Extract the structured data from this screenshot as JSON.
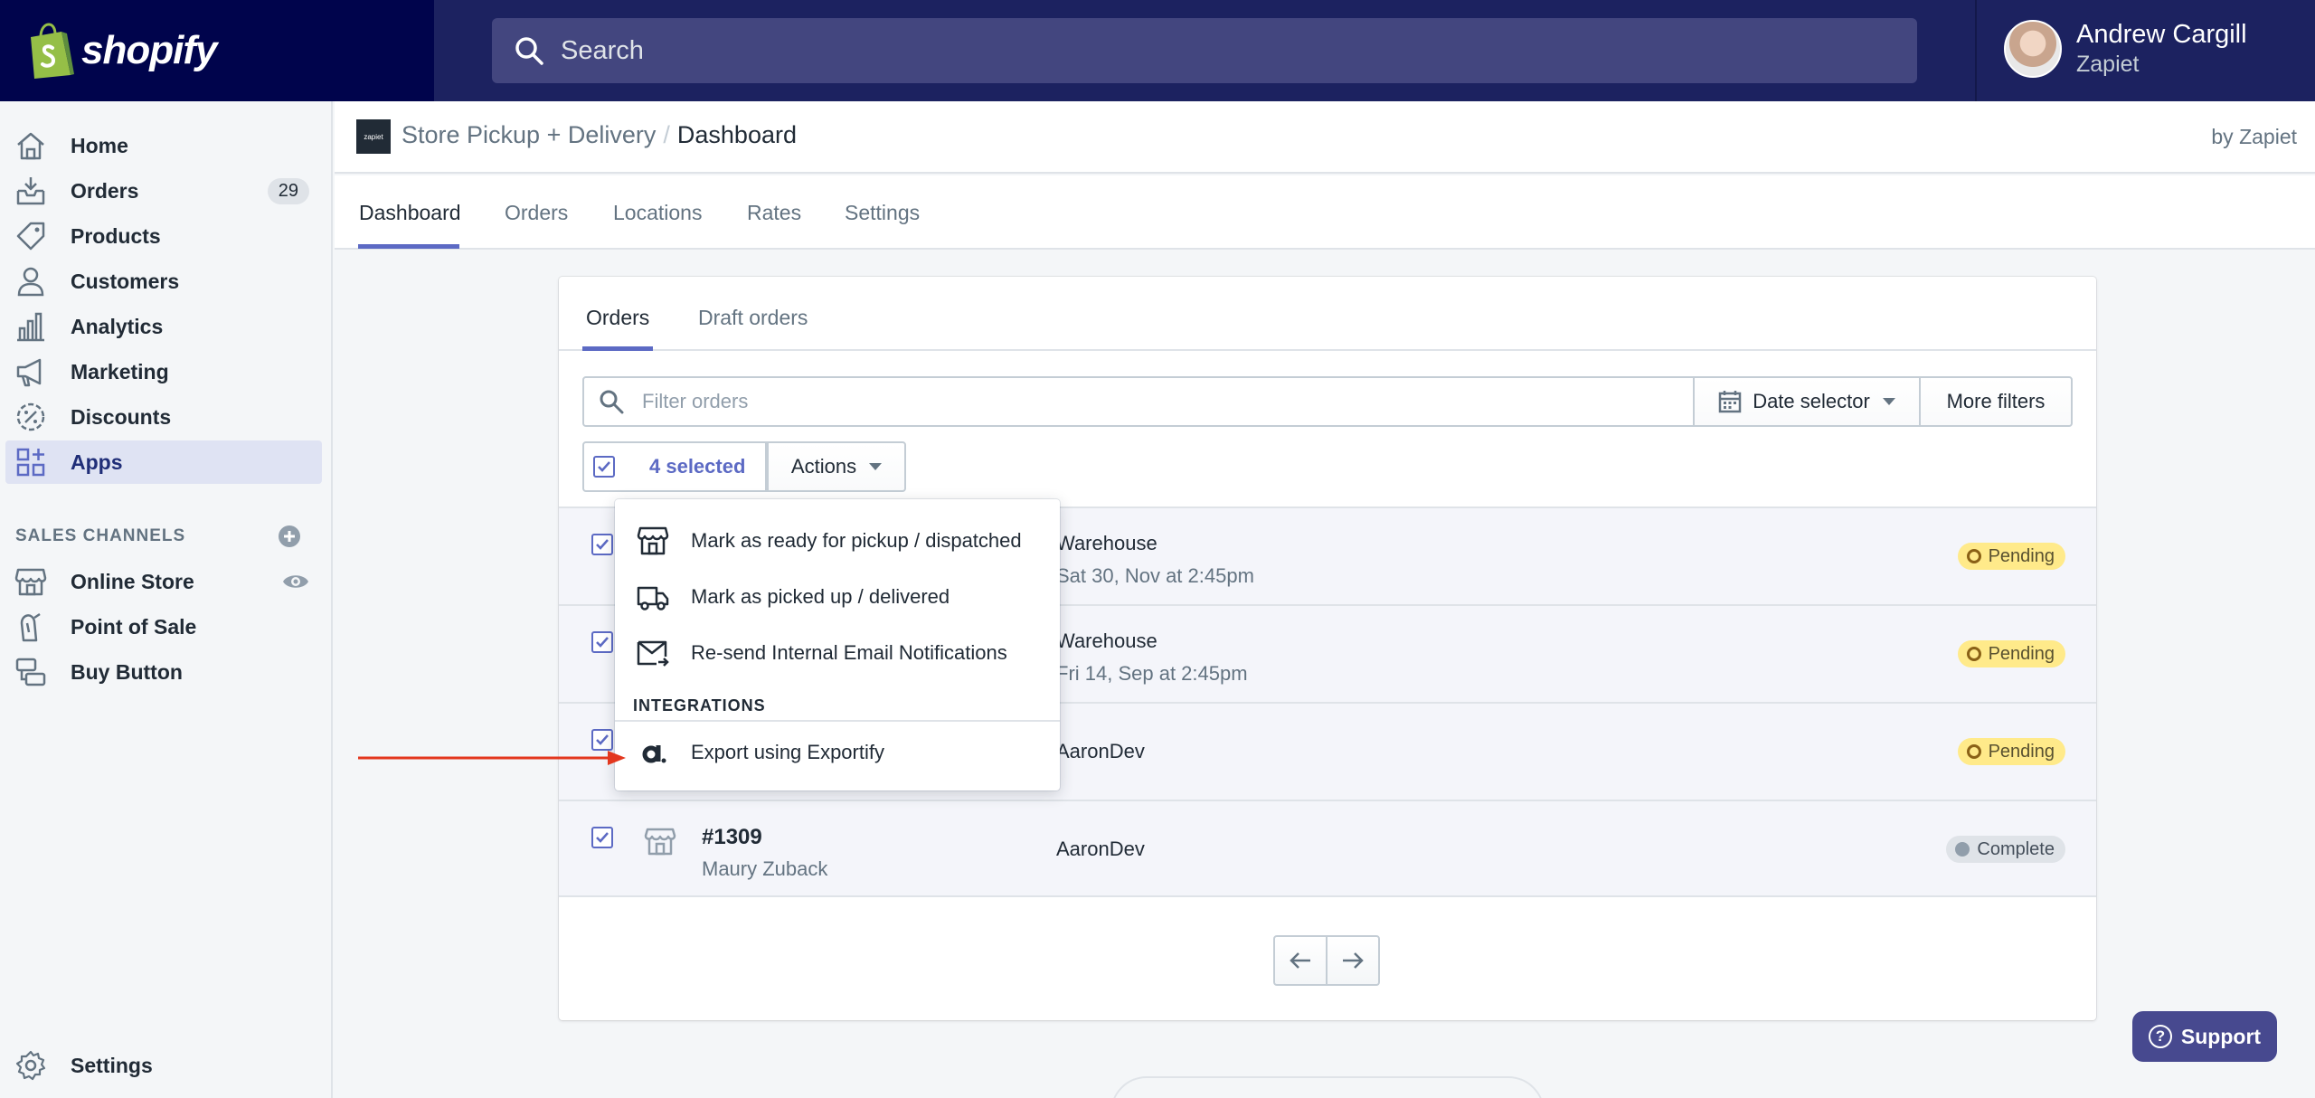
{
  "brand": {
    "name": "shopify"
  },
  "search": {
    "placeholder": "Search"
  },
  "user": {
    "name": "Andrew Cargill",
    "store": "Zapiet"
  },
  "sidebar": {
    "items": [
      {
        "label": "Home",
        "icon": "home-icon"
      },
      {
        "label": "Orders",
        "icon": "orders-icon",
        "badge": "29"
      },
      {
        "label": "Products",
        "icon": "tag-icon"
      },
      {
        "label": "Customers",
        "icon": "person-icon"
      },
      {
        "label": "Analytics",
        "icon": "chart-icon"
      },
      {
        "label": "Marketing",
        "icon": "megaphone-icon"
      },
      {
        "label": "Discounts",
        "icon": "discount-icon"
      },
      {
        "label": "Apps",
        "icon": "apps-icon",
        "active": true
      }
    ],
    "sales_channels_title": "SALES CHANNELS",
    "channels": [
      {
        "label": "Online Store",
        "icon": "store-icon"
      },
      {
        "label": "Point of Sale",
        "icon": "pos-icon"
      },
      {
        "label": "Buy Button",
        "icon": "buy-button-icon"
      }
    ],
    "settings_label": "Settings"
  },
  "app": {
    "logo_text": "zapiet",
    "name": "Store Pickup + Delivery",
    "separator": "/",
    "page": "Dashboard",
    "by": "by Zapiet",
    "tabs": [
      "Dashboard",
      "Orders",
      "Locations",
      "Rates",
      "Settings"
    ],
    "active_tab": "Dashboard"
  },
  "card": {
    "tabs": [
      "Orders",
      "Draft orders"
    ],
    "filter_placeholder": "Filter orders",
    "date_selector": "Date selector",
    "more_filters": "More filters",
    "selected_label": "4 selected",
    "actions_label": "Actions"
  },
  "orders": [
    {
      "location": "Warehouse",
      "date": "Sat 30, Nov at 2:45pm",
      "status": "Pending"
    },
    {
      "location": "Warehouse",
      "date": "Fri 14, Sep at 2:45pm",
      "status": "Pending"
    },
    {
      "location": "AaronDev",
      "status": "Pending"
    },
    {
      "number": "#1309",
      "customer": "Maury Zuback",
      "location": "AaronDev",
      "status": "Complete"
    }
  ],
  "menu": {
    "items": [
      {
        "label": "Mark as ready for pickup / dispatched",
        "icon": "store-icon"
      },
      {
        "label": "Mark as picked up / delivered",
        "icon": "truck-icon"
      },
      {
        "label": "Re-send Internal Email Notifications",
        "icon": "mail-icon"
      }
    ],
    "section_title": "INTEGRATIONS",
    "integration": {
      "label": "Export using Exportify",
      "icon": "exportify-icon"
    }
  },
  "support": {
    "label": "Support"
  },
  "colors": {
    "accent": "#5c6ac4",
    "topbar": "#1c2260",
    "brand_bg": "#00044c",
    "pending": "#ffea8a",
    "arrow": "#e3371e"
  }
}
